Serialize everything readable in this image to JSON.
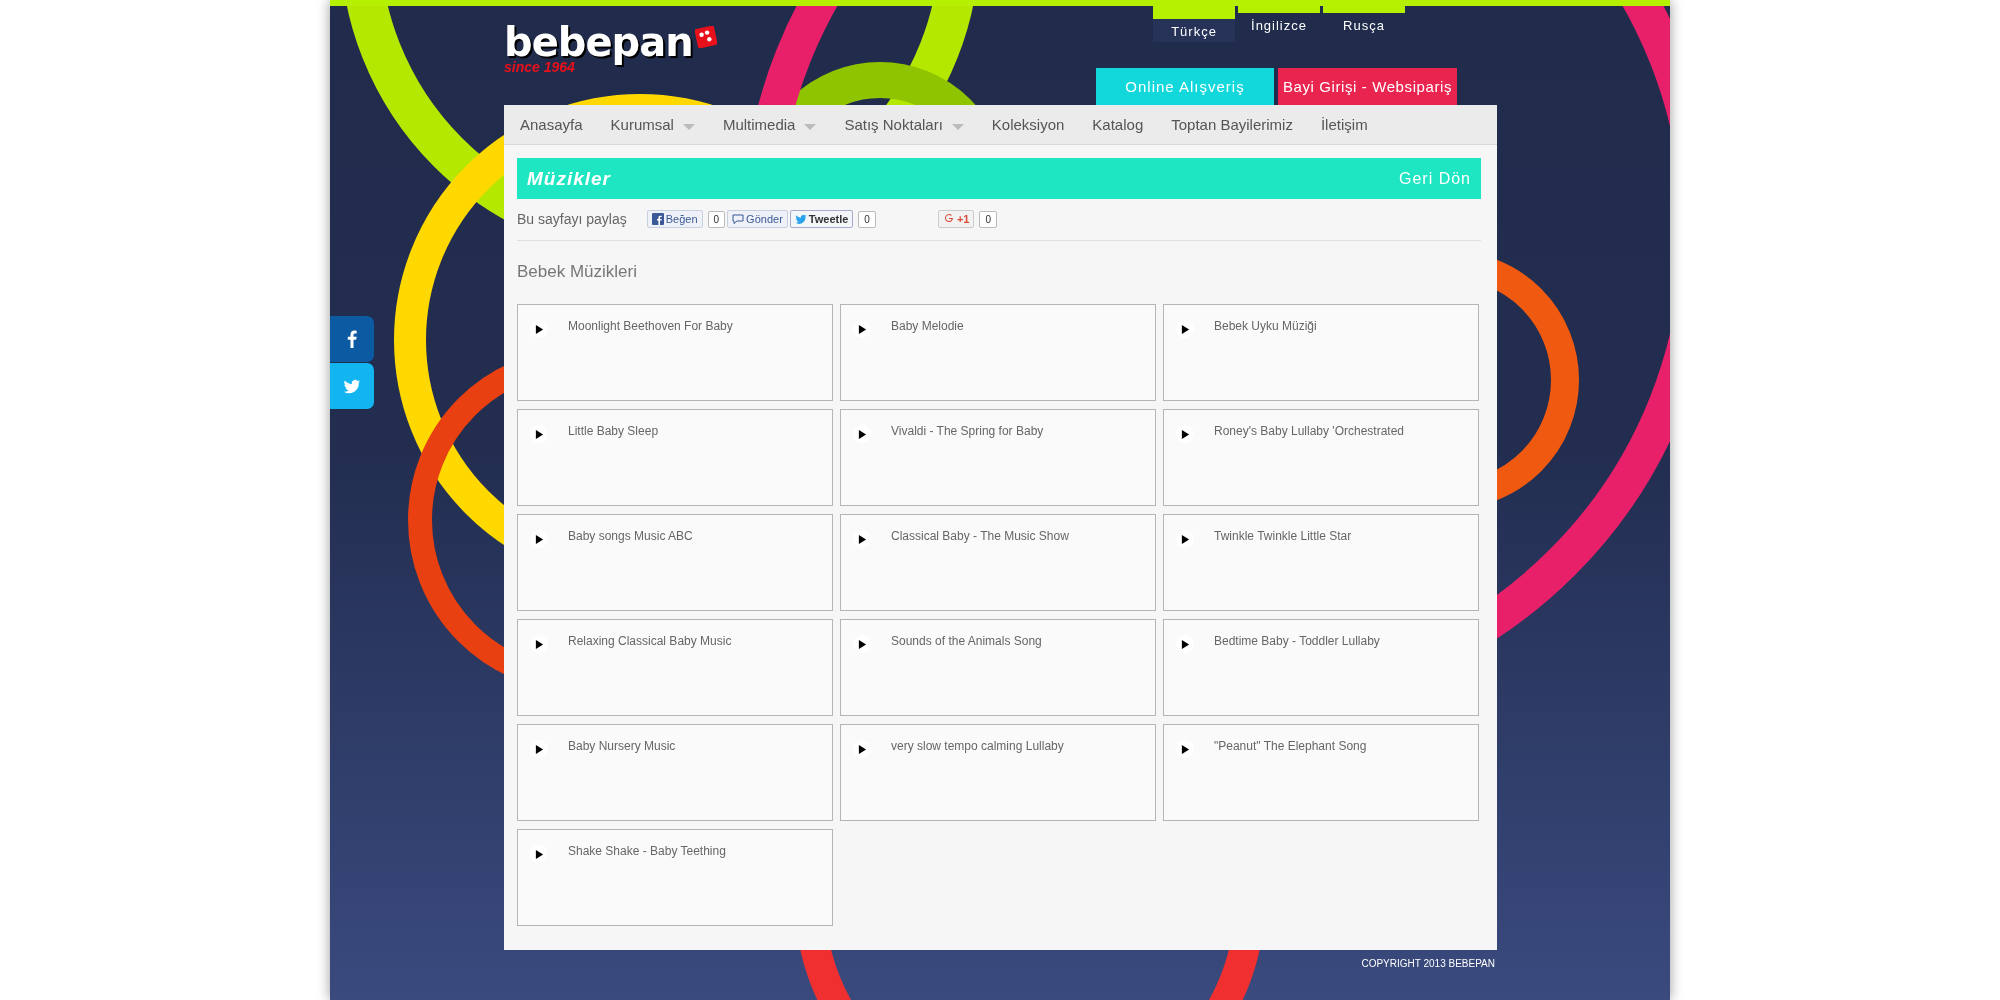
{
  "logo": {
    "name": "bebepan",
    "tagline": "since 1964"
  },
  "languages": [
    {
      "label": "Türkçe",
      "selected": true
    },
    {
      "label": "İngilizce",
      "selected": false
    },
    {
      "label": "Rusça",
      "selected": false
    }
  ],
  "top_buttons": [
    {
      "label": "Online Alışveriş",
      "kind": "shop"
    },
    {
      "label": "Bayi Girişi - Websipariş",
      "kind": "dealer"
    }
  ],
  "nav": [
    {
      "label": "Anasayfa",
      "dropdown": false
    },
    {
      "label": "Kurumsal",
      "dropdown": true
    },
    {
      "label": "Multimedia",
      "dropdown": true
    },
    {
      "label": "Satış Noktaları",
      "dropdown": true
    },
    {
      "label": "Koleksiyon",
      "dropdown": false
    },
    {
      "label": "Katalog",
      "dropdown": false
    },
    {
      "label": "Toptan Bayilerimiz",
      "dropdown": false
    },
    {
      "label": "İletişim",
      "dropdown": false
    }
  ],
  "page_header": {
    "title": "Müzikler",
    "back": "Geri Dön"
  },
  "share": {
    "label": "Bu sayfayı paylaş",
    "buttons": [
      {
        "kind": "facebook",
        "label": "Beğen",
        "count": "0"
      },
      {
        "kind": "send",
        "label": "Gönder"
      },
      {
        "kind": "twitter",
        "label": "Tweetle",
        "count": "0"
      },
      {
        "kind": "gplus",
        "label": "+1",
        "count": "0"
      }
    ]
  },
  "section_title": "Bebek Müzikleri",
  "tracks": [
    {
      "title": "Moonlight Beethoven For Baby"
    },
    {
      "title": "Baby Melodie"
    },
    {
      "title": "Bebek Uyku Müziği"
    },
    {
      "title": "Little Baby Sleep"
    },
    {
      "title": "Vivaldi - The Spring for Baby"
    },
    {
      "title": "Roney's Baby Lullaby 'Orchestrated"
    },
    {
      "title": "Baby songs Music ABC"
    },
    {
      "title": "Classical Baby - The Music Show"
    },
    {
      "title": "Twinkle Twinkle Little Star"
    },
    {
      "title": "Relaxing Classical Baby Music"
    },
    {
      "title": "Sounds of the Animals Song"
    },
    {
      "title": "Bedtime Baby - Toddler Lullaby"
    },
    {
      "title": "Baby Nursery Music"
    },
    {
      "title": "very slow tempo calming Lullaby"
    },
    {
      "title": "\"Peanut\" The Elephant Song"
    },
    {
      "title": "Shake Shake - Baby Teething"
    }
  ],
  "side_social": [
    {
      "kind": "facebook"
    },
    {
      "kind": "twitter"
    }
  ],
  "footer": "COPYRIGHT 2013 BEBEPAN"
}
